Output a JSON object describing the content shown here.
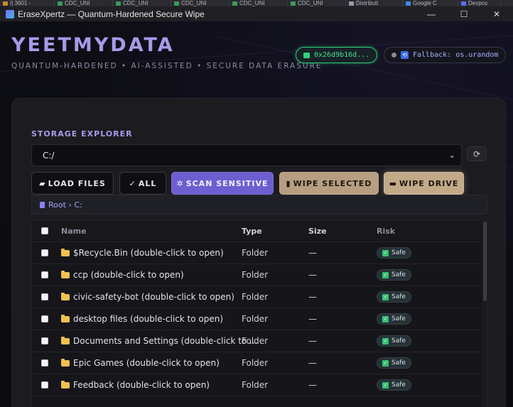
{
  "browser_tabs": [
    {
      "label": "I| 3601 -",
      "color": "#c98b2e"
    },
    {
      "label": "CDC_UNI",
      "color": "#3a9b5a"
    },
    {
      "label": "CDC_UNI",
      "color": "#3a9b5a"
    },
    {
      "label": "CDC_UNI",
      "color": "#3a9b5a"
    },
    {
      "label": "CDC_UNI",
      "color": "#3a9b5a"
    },
    {
      "label": "CDC_UNI",
      "color": "#3a9b5a"
    },
    {
      "label": "Distributi",
      "color": "#9a9aa8"
    },
    {
      "label": "Google C",
      "color": "#4285f4"
    },
    {
      "label": "Devpos",
      "color": "#5a6cf0"
    }
  ],
  "window": {
    "title": "EraseXpertz — Quantum-Hardened Secure Wipe",
    "minimize": "—",
    "maximize": "☐",
    "close": "✕"
  },
  "header": {
    "brand": "YEETMYDATA",
    "tagline": "QUANTUM-HARDENED • AI-ASSISTED • SECURE DATA ERASURE",
    "key_status": "0x26d9b16d...",
    "rng_status": "Fallback: os.urandom"
  },
  "explorer": {
    "title": "STORAGE EXPLORER",
    "selected_drive": "C:/",
    "refresh_icon": "⟳",
    "buttons": {
      "load_files": "LOAD FILES",
      "all": "ALL",
      "scan_sensitive": "SCAN SENSITIVE",
      "wipe_selected": "WIPE SELECTED",
      "wipe_drive": "WIPE DRIVE"
    },
    "breadcrumb": "Root › C:",
    "columns": {
      "name": "Name",
      "type": "Type",
      "size": "Size",
      "risk": "Risk"
    },
    "rows": [
      {
        "name": "$Recycle.Bin (double-click to open)",
        "type": "Folder",
        "size": "—",
        "risk": "Safe"
      },
      {
        "name": "ccp (double-click to open)",
        "type": "Folder",
        "size": "—",
        "risk": "Safe"
      },
      {
        "name": "civic-safety-bot (double-click to open)",
        "type": "Folder",
        "size": "—",
        "risk": "Safe"
      },
      {
        "name": "desktop files (double-click to open)",
        "type": "Folder",
        "size": "—",
        "risk": "Safe"
      },
      {
        "name": "Documents and Settings (double-click to ...",
        "type": "Folder",
        "size": "—",
        "risk": "Safe"
      },
      {
        "name": "Epic Games (double-click to open)",
        "type": "Folder",
        "size": "—",
        "risk": "Safe"
      },
      {
        "name": "Feedback (double-click to open)",
        "type": "Folder",
        "size": "—",
        "risk": "Safe"
      }
    ]
  },
  "colors": {
    "accent": "#a99ae8",
    "key_green": "#2fd17a",
    "scan_purple": "#6d5fcf",
    "wipe_tan": "#b79e80",
    "safe_green": "#34c26f",
    "folder_yellow": "#f2c14e"
  }
}
